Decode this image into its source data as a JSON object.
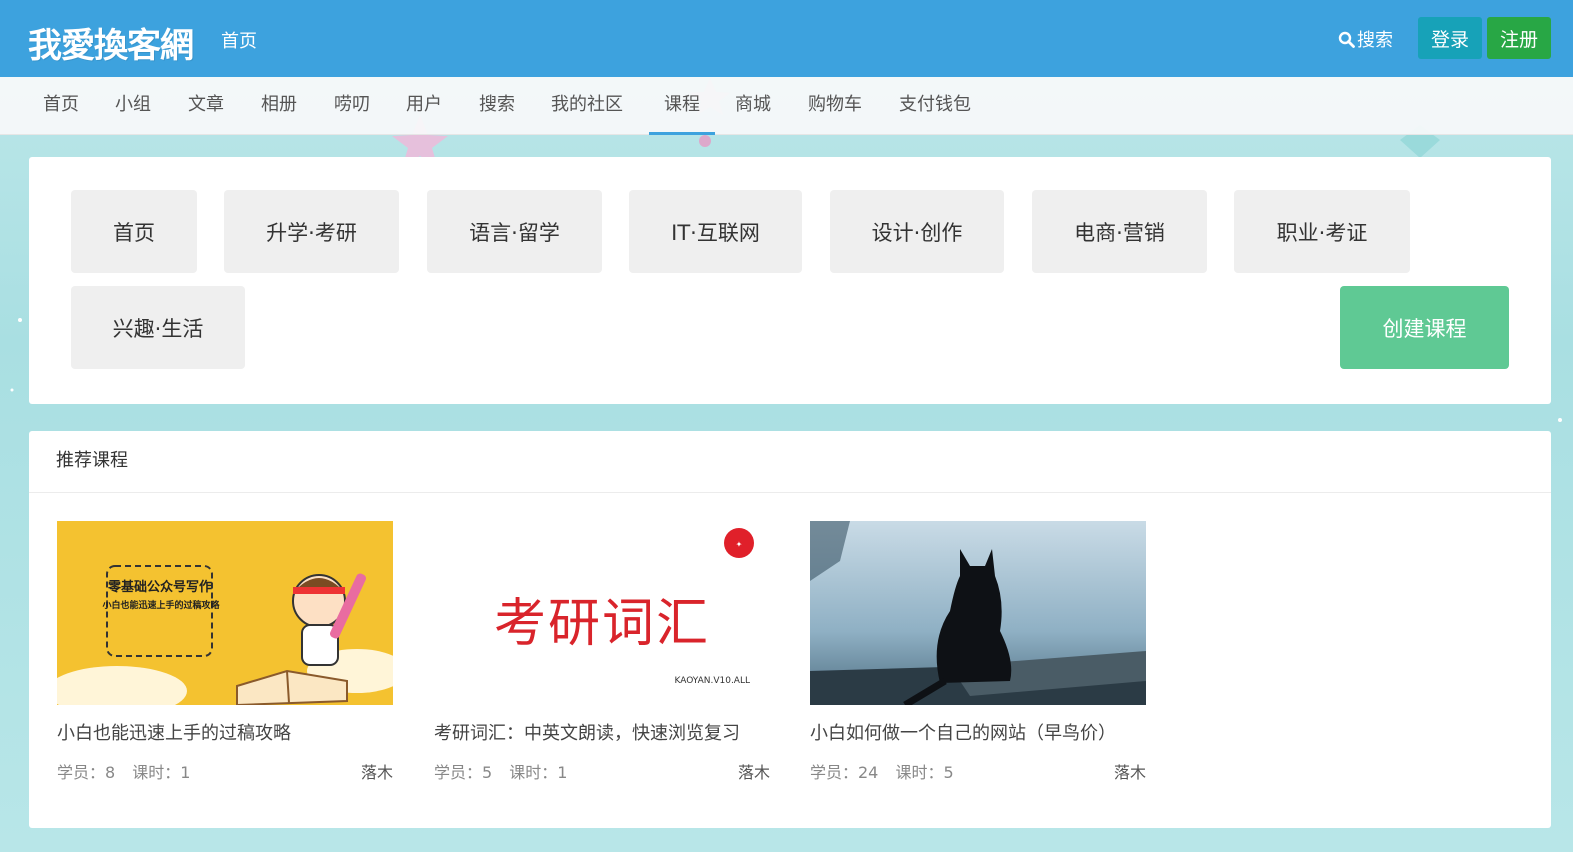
{
  "header": {
    "logo": "我愛換客網",
    "home": "首页",
    "search": "搜索",
    "login": "登录",
    "register": "注册"
  },
  "subnav": {
    "items": [
      "首页",
      "小组",
      "文章",
      "相册",
      "唠叨",
      "用户",
      "搜索",
      "我的社区",
      "课程",
      "商城",
      "购物车",
      "支付钱包"
    ],
    "active": "课程"
  },
  "categories": {
    "items": [
      "首页",
      "升学·考研",
      "语言·留学",
      "IT·互联网",
      "设计·创作",
      "电商·营销",
      "职业·考证",
      "兴趣·生活"
    ],
    "create": "创建课程"
  },
  "recommended": {
    "title": "推荐课程",
    "courses": [
      {
        "title": "小白也能迅速上手的过稿攻略",
        "students": "学员：8",
        "lessons": "课时：1",
        "author": "落木",
        "thumb_heading": "零基础公众号写作",
        "thumb_sub": "小白也能迅速上手的过稿攻略"
      },
      {
        "title": "考研词汇：中英文朗读，快速浏览复习",
        "students": "学员：5",
        "lessons": "课时：1",
        "author": "落木",
        "thumb_heading": "考研词汇",
        "thumb_code": "KAOYAN.V10.ALL"
      },
      {
        "title": "小白如何做一个自己的网站（早鸟价）",
        "students": "学员：24",
        "lessons": "课时：5",
        "author": "落木"
      }
    ]
  }
}
